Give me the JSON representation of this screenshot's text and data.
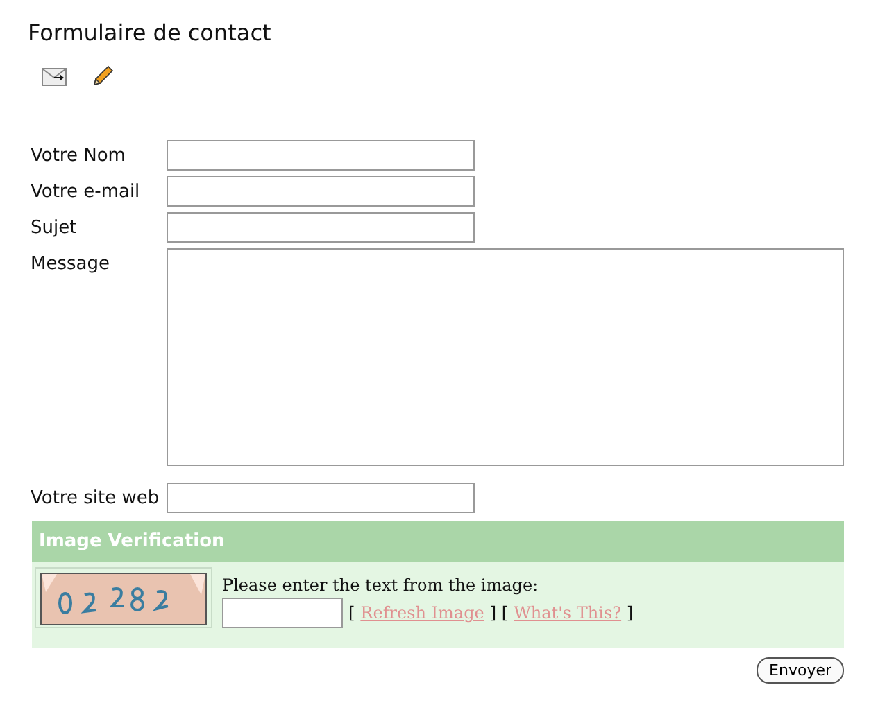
{
  "title": "Formulaire de contact",
  "fields": [
    {
      "label": "Votre Nom",
      "kind": "input"
    },
    {
      "label": "Votre e-mail",
      "kind": "input"
    },
    {
      "label": "Sujet",
      "kind": "input"
    },
    {
      "label": "Message",
      "kind": "textarea"
    },
    {
      "label": "Votre site web",
      "kind": "input"
    }
  ],
  "verification": {
    "heading": "Image Verification",
    "prompt": "Please enter the text from the image:",
    "open_bracket": "[",
    "refresh_link": "Refresh Image",
    "middle_brackets": "] [",
    "whats_this_link": "What's This?",
    "close_bracket": "]"
  },
  "submit": "Envoyer"
}
